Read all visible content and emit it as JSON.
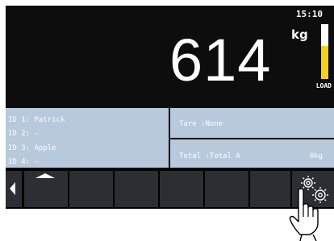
{
  "status": {
    "time": "15:10"
  },
  "display": {
    "weight": "614",
    "unit": "kg",
    "load_label": "LOAD",
    "load_level": 0.6
  },
  "ids": [
    {
      "label": "ID 1: Patrick"
    },
    {
      "label": "ID 2: -"
    },
    {
      "label": "ID 3: Apple"
    },
    {
      "label": "ID 4: -"
    }
  ],
  "tare": {
    "label": "Tare :None"
  },
  "total": {
    "label": "Total :Total A",
    "value": "0kg"
  },
  "softkeys": {
    "count": 8,
    "left_arrow": "left-arrow-icon",
    "up_arrow": "up-arrow-icon",
    "settings": "gear-icon"
  },
  "colors": {
    "screen_bg": "#0d0d0d",
    "panel_bg": "#b7c9db",
    "load_fill": "#f5d21a",
    "key_bg": "#2b2f34"
  }
}
